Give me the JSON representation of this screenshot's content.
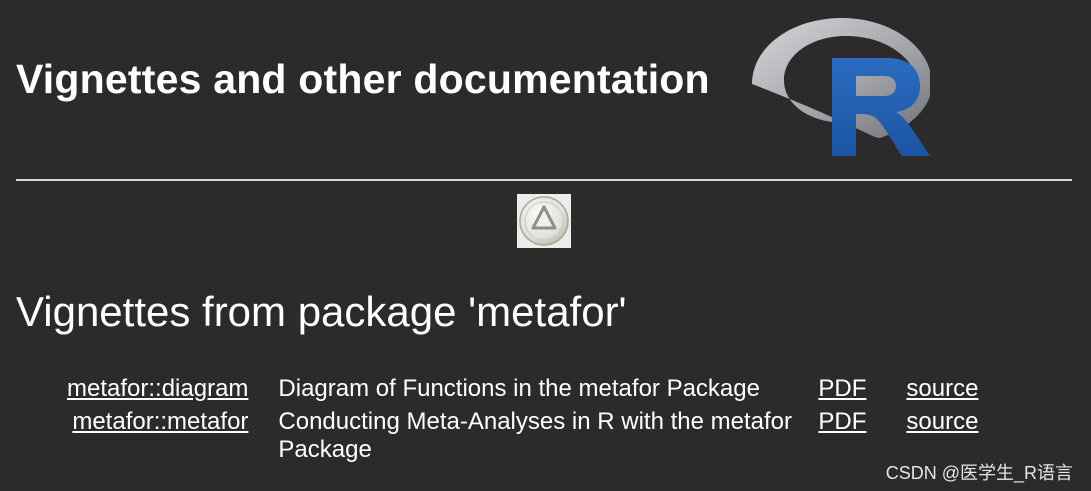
{
  "header": {
    "title": "Vignettes and other documentation",
    "logo_letter": "R"
  },
  "navigation": {
    "up_icon": "up-arrow-icon"
  },
  "section": {
    "heading": "Vignettes from package 'metafor'"
  },
  "vignettes": [
    {
      "name": "metafor::diagram",
      "description": "Diagram of Functions in the metafor Package",
      "pdf": "PDF",
      "source": "source"
    },
    {
      "name": "metafor::metafor",
      "description": "Conducting Meta-Analyses in R with the metafor Package",
      "pdf": "PDF",
      "source": "source"
    }
  ],
  "watermark": "CSDN @医学生_R语言",
  "colors": {
    "background": "#2c2a2b",
    "text": "#ffffff",
    "r_logo_blue": "#1f5fb2",
    "r_logo_ring": "#a5a7ab"
  }
}
